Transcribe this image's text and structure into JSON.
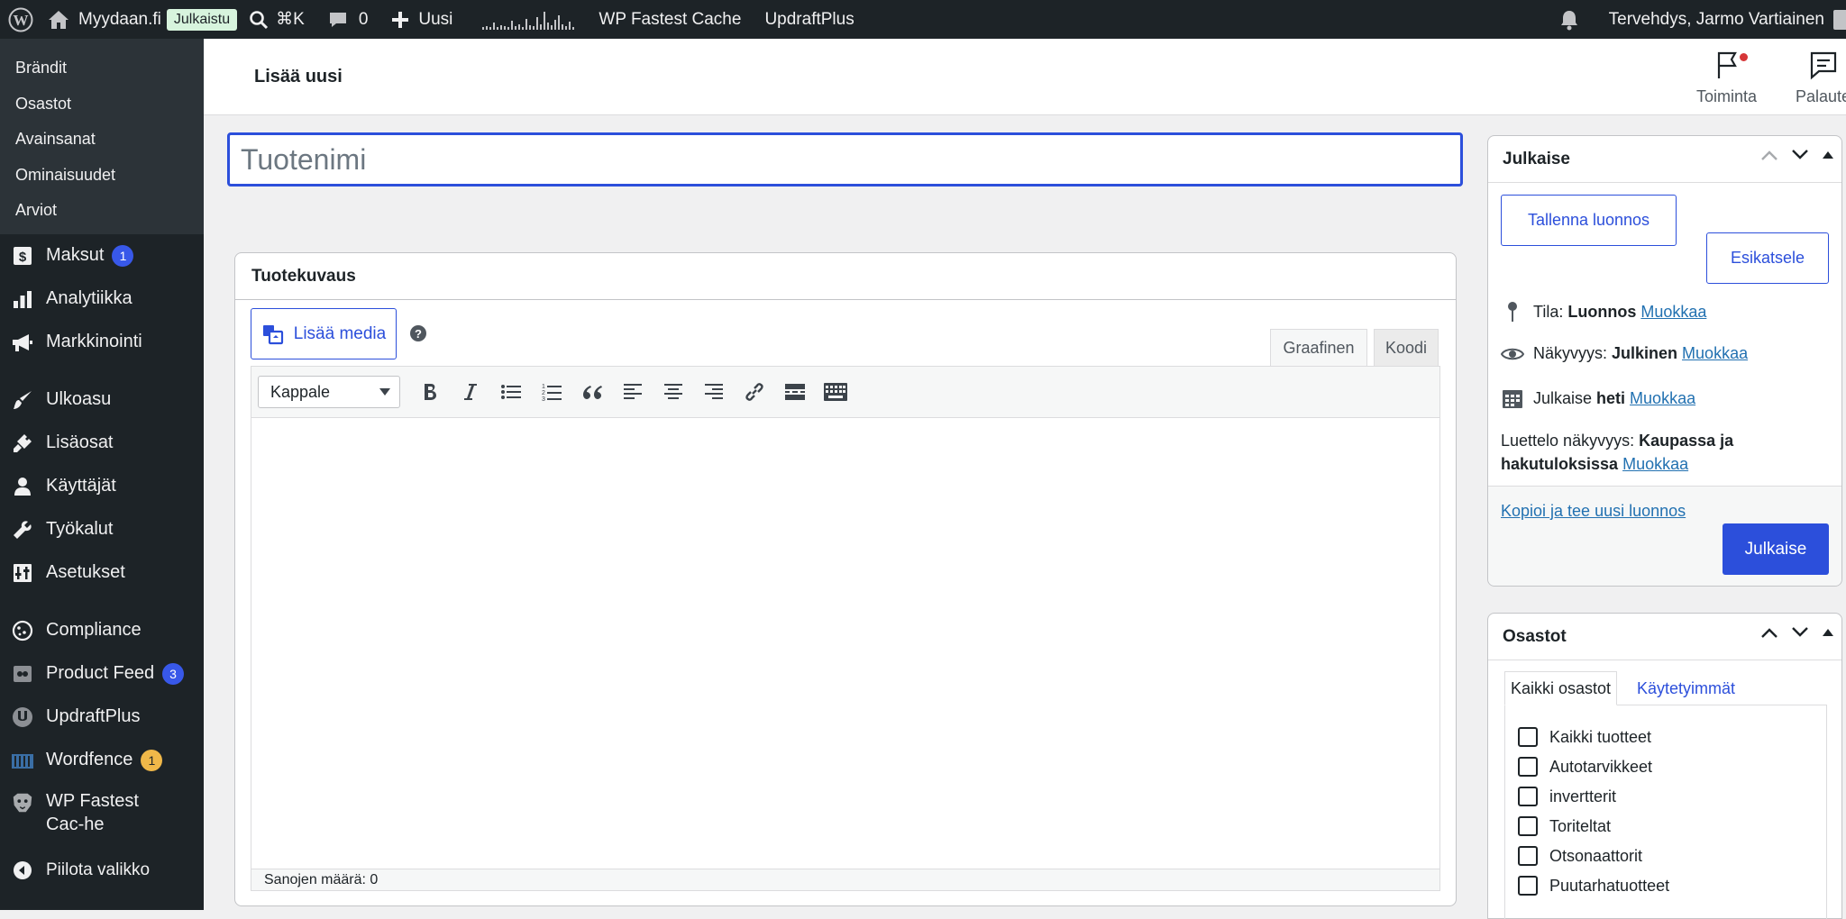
{
  "adminbar": {
    "site_name": "Myydaan.fi",
    "site_status_badge": "Julkaistu",
    "search_shortcut": "⌘K",
    "comments_count": "0",
    "new_label": "Uusi",
    "cache_plugin": "WP Fastest Cache",
    "backup_plugin": "UpdraftPlus",
    "greeting": "Tervehdys, Jarmo Vartiainen"
  },
  "sidebar": {
    "submenu": [
      "Brändit",
      "Osastot",
      "Avainsanat",
      "Ominaisuudet",
      "Arviot"
    ],
    "items": [
      {
        "label": "Maksut",
        "icon": "payments-icon",
        "badge": "1"
      },
      {
        "label": "Analytiikka",
        "icon": "bar-chart-icon"
      },
      {
        "label": "Markkinointi",
        "icon": "megaphone-icon"
      },
      {
        "label": "Ulkoasu",
        "icon": "paintbrush-icon"
      },
      {
        "label": "Lisäosat",
        "icon": "plugin-icon"
      },
      {
        "label": "Käyttäjät",
        "icon": "user-icon"
      },
      {
        "label": "Työkalut",
        "icon": "wrench-icon"
      },
      {
        "label": "Asetukset",
        "icon": "settings-sliders-icon"
      },
      {
        "label": "Compliance",
        "icon": "cookie-icon"
      },
      {
        "label": "Product Feed",
        "icon": "product-feed-icon",
        "badge": "3"
      },
      {
        "label": "UpdraftPlus",
        "icon": "updraft-icon"
      },
      {
        "label": "Wordfence",
        "icon": "wordfence-icon",
        "badge": "1"
      },
      {
        "label": "WP Fastest Cac-he",
        "icon": "cheetah-icon"
      },
      {
        "label": "Piilota valikko",
        "icon": "collapse-icon"
      }
    ]
  },
  "header": {
    "title": "Lisää uusi",
    "activity_label": "Toiminta",
    "feedback_label": "Palaute"
  },
  "title_field": {
    "placeholder": "Tuotenimi",
    "value": ""
  },
  "editor": {
    "box_title": "Tuotekuvaus",
    "add_media": "Lisää media",
    "help": "?",
    "tab_visual": "Graafinen",
    "tab_text": "Koodi",
    "format_select": "Kappale",
    "word_count": "Sanojen määrä: 0"
  },
  "publish": {
    "title": "Julkaise",
    "save_draft": "Tallenna luonnos",
    "preview": "Esikatsele",
    "status_label": "Tila:",
    "status_value": "Luonnos",
    "visibility_label": "Näkyvyys:",
    "visibility_value": "Julkinen",
    "schedule_label": "Julkaise",
    "schedule_value": "heti",
    "edit_link": "Muokkaa",
    "catalog_label": "Luettelo näkyvyys:",
    "catalog_value": "Kaupassa ja hakutuloksissa",
    "copy_draft": "Kopioi ja tee uusi luonnos",
    "publish_button": "Julkaise"
  },
  "categories": {
    "title": "Osastot",
    "tab_all": "Kaikki osastot",
    "tab_popular": "Käytetyimmät",
    "items": [
      "Kaikki tuotteet",
      "Autotarvikkeet",
      "invertterit",
      "Toriteltat",
      "Otsonaattorit",
      "Puutarhatuotteet"
    ]
  },
  "colors": {
    "accent": "#2c4fdb",
    "adminbar_bg": "#1d2327",
    "sidebar_bg": "#1d2327",
    "submenu_bg": "#2c3338",
    "badge_blue": "#3858e9",
    "badge_orange": "#f0b849",
    "notification_dot": "#d63638"
  }
}
